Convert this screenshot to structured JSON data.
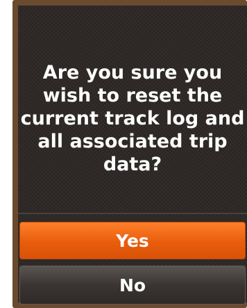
{
  "dialog": {
    "message": "Are you sure you wish to reset the current track log and all associated trip data?",
    "yes_label": "Yes",
    "no_label": "No"
  },
  "colors": {
    "screen_background": "#2a2522",
    "yes_button": "#e85d0c",
    "no_button": "#3a3533",
    "frame": "#6b4a2e",
    "text": "#ffffff"
  }
}
